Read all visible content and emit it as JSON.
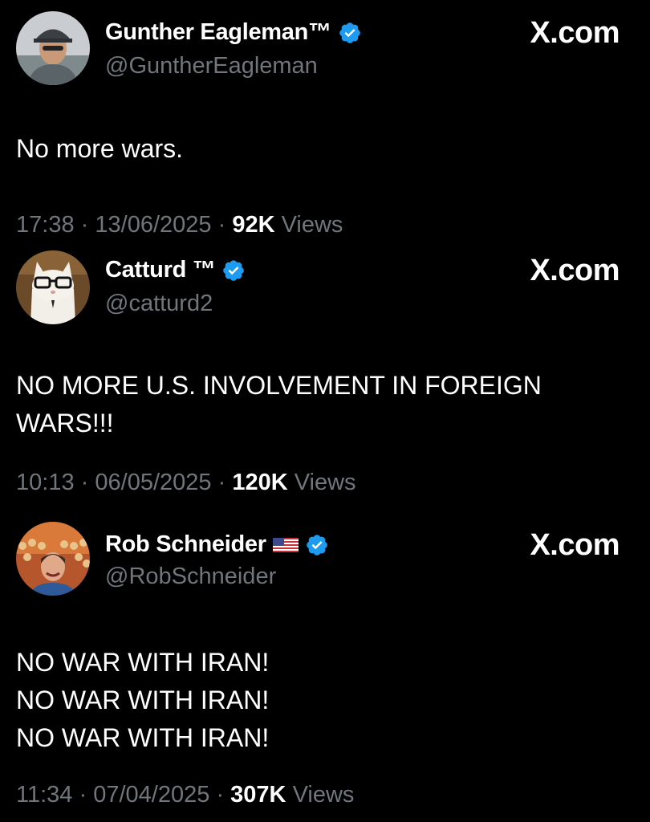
{
  "tweets": [
    {
      "name": "Gunther Eagleman™",
      "handle": "@GuntherEagleman",
      "source": "X.com",
      "verified": true,
      "avatar_icon": "profile-photo-man-in-cap",
      "text_lines": [
        "No more wars."
      ],
      "time": "17:38",
      "date": "13/06/2025",
      "views_count": "92K",
      "views_label": "Views",
      "separator": "·"
    },
    {
      "name": "Catturd ™",
      "handle": "@catturd2",
      "source": "X.com",
      "verified": true,
      "avatar_icon": "profile-photo-cat-with-glasses",
      "text_lines": [
        "NO MORE U.S. INVOLVEMENT IN FOREIGN",
        "WARS!!!"
      ],
      "time": "10:13",
      "date": "06/05/2025",
      "views_count": "120K",
      "views_label": "Views",
      "separator": "·"
    },
    {
      "name": "Rob Schneider",
      "handle": "@RobSchneider",
      "source": "X.com",
      "verified": true,
      "flag_icon": "us-flag-icon",
      "avatar_icon": "profile-photo-man-in-crowd",
      "text_lines": [
        "NO WAR WITH IRAN!",
        "NO WAR WITH IRAN!",
        "NO WAR WITH IRAN!"
      ],
      "time": "11:34",
      "date": "07/04/2025",
      "views_count": "307K",
      "views_label": "Views",
      "separator": "·"
    }
  ],
  "colors": {
    "background": "#000000",
    "text": "#ffffff",
    "muted": "#71767b",
    "verified_badge": "#1d9bf0"
  }
}
